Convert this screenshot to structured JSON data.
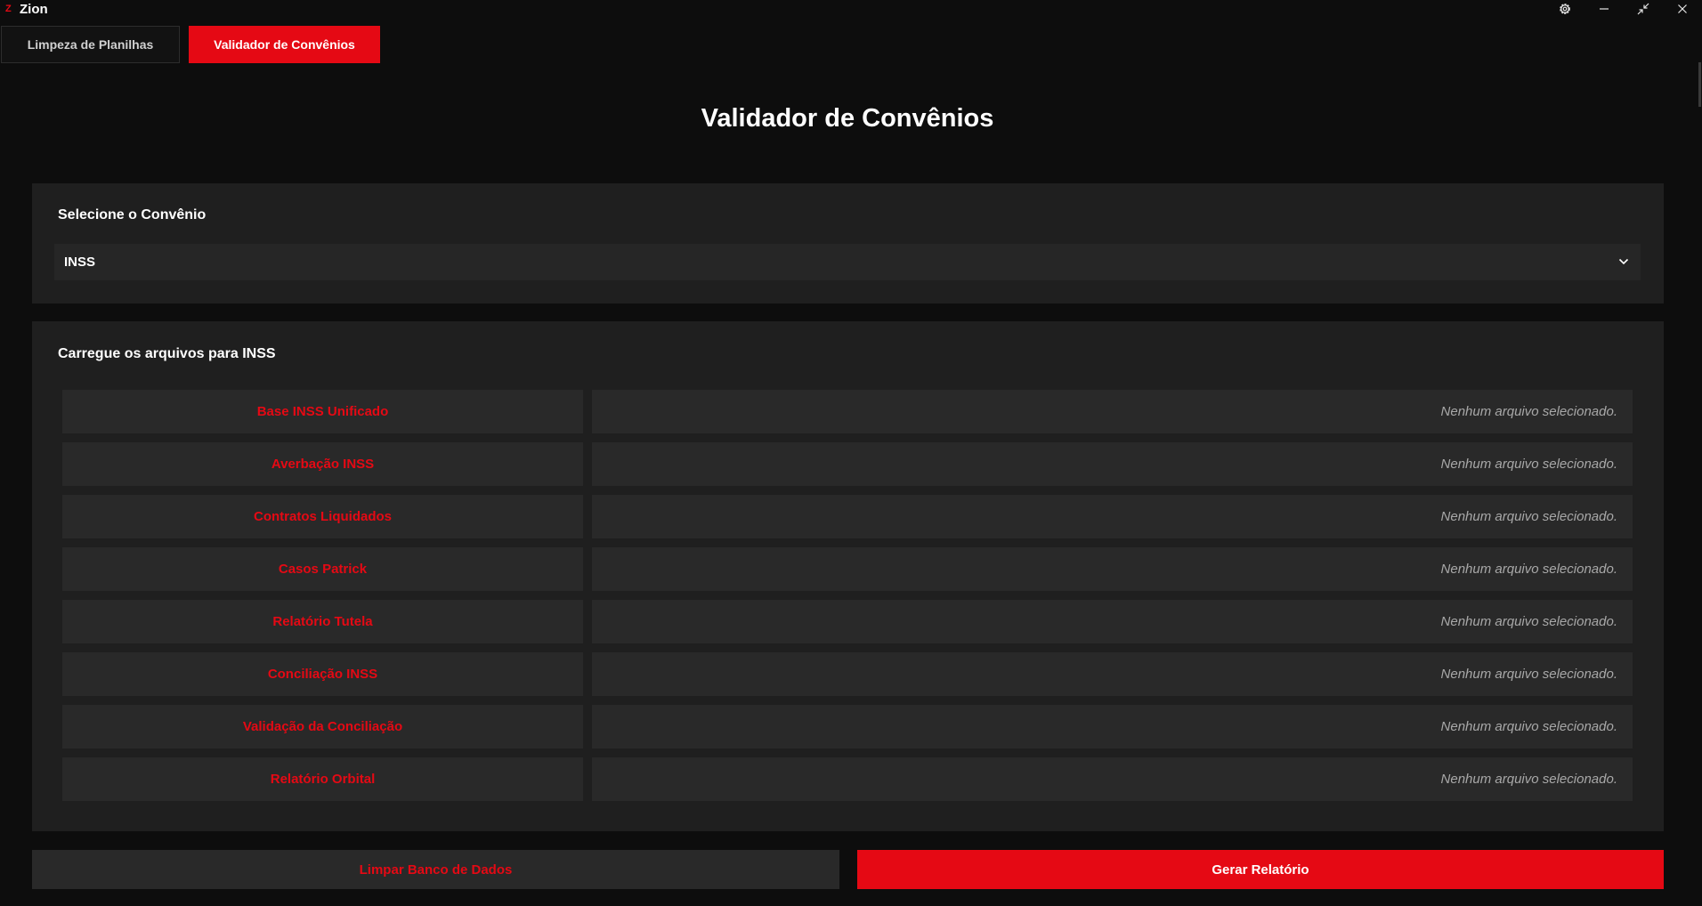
{
  "window": {
    "logo_letter": "Z",
    "title": "Zion",
    "controls": {
      "settings_icon": "gear-icon",
      "minimize_icon": "minimize-icon",
      "restore_icon": "restore-icon",
      "close_icon": "close-icon"
    }
  },
  "tabs": [
    {
      "label": "Limpeza de Planilhas",
      "active": false
    },
    {
      "label": "Validador de Convênios",
      "active": true
    }
  ],
  "page": {
    "title": "Validador de Convênios"
  },
  "convenio": {
    "heading": "Selecione o Convênio",
    "selected": "INSS",
    "chevron_icon": "chevron-down-icon"
  },
  "files": {
    "heading": "Carregue os arquivos para INSS",
    "rows": [
      {
        "label": "Base INSS Unificado",
        "status": "Nenhum arquivo selecionado."
      },
      {
        "label": "Averbação INSS",
        "status": "Nenhum arquivo selecionado."
      },
      {
        "label": "Contratos Liquidados",
        "status": "Nenhum arquivo selecionado."
      },
      {
        "label": "Casos Patrick",
        "status": "Nenhum arquivo selecionado."
      },
      {
        "label": "Relatório Tutela",
        "status": "Nenhum arquivo selecionado."
      },
      {
        "label": "Conciliação INSS",
        "status": "Nenhum arquivo selecionado."
      },
      {
        "label": "Validação da Conciliação",
        "status": "Nenhum arquivo selecionado."
      },
      {
        "label": "Relatório Orbital",
        "status": "Nenhum arquivo selecionado."
      }
    ]
  },
  "actions": {
    "clear_label": "Limpar Banco de Dados",
    "generate_label": "Gerar Relatório"
  },
  "colors": {
    "accent": "#e50914",
    "background": "#0d0d0d",
    "panel": "#1f1f1f",
    "field": "#292929",
    "muted_text": "#a8a8a8"
  }
}
